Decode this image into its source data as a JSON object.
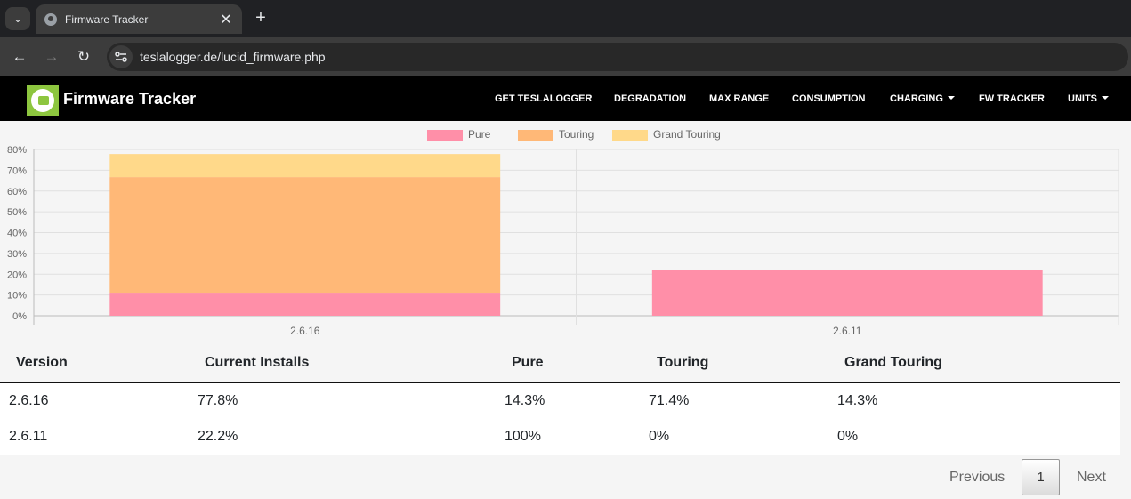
{
  "browser": {
    "tab_title": "Firmware Tracker",
    "url": "teslalogger.de/lucid_firmware.php"
  },
  "site": {
    "brand": "Firmware Tracker",
    "nav": [
      {
        "label": "GET TESLALOGGER",
        "dropdown": false
      },
      {
        "label": "DEGRADATION",
        "dropdown": false
      },
      {
        "label": "MAX RANGE",
        "dropdown": false
      },
      {
        "label": "CONSUMPTION",
        "dropdown": false
      },
      {
        "label": "CHARGING",
        "dropdown": true
      },
      {
        "label": "FW TRACKER",
        "dropdown": false
      },
      {
        "label": "UNITS",
        "dropdown": true
      }
    ]
  },
  "chart_data": {
    "type": "bar",
    "stacked": true,
    "categories": [
      "2.6.16",
      "2.6.11"
    ],
    "series": [
      {
        "name": "Pure",
        "values": [
          11.1,
          22.2
        ],
        "color": "#ff8fa8"
      },
      {
        "name": "Touring",
        "values": [
          55.6,
          0
        ],
        "color": "#ffb877"
      },
      {
        "name": "Grand Touring",
        "values": [
          11.1,
          0
        ],
        "color": "#ffd98a"
      }
    ],
    "ylim": [
      0,
      80
    ],
    "yticks": [
      "0%",
      "10%",
      "20%",
      "30%",
      "40%",
      "50%",
      "60%",
      "70%",
      "80%"
    ],
    "grid": true,
    "legend_position": "top"
  },
  "table": {
    "headers": [
      "Version",
      "Current Installs",
      "Pure",
      "Touring",
      "Grand Touring"
    ],
    "rows": [
      [
        "2.6.16",
        "77.8%",
        "14.3%",
        "71.4%",
        "14.3%"
      ],
      [
        "2.6.11",
        "22.2%",
        "100%",
        "0%",
        "0%"
      ]
    ]
  },
  "pagination": {
    "previous": "Previous",
    "current": "1",
    "next": "Next"
  }
}
